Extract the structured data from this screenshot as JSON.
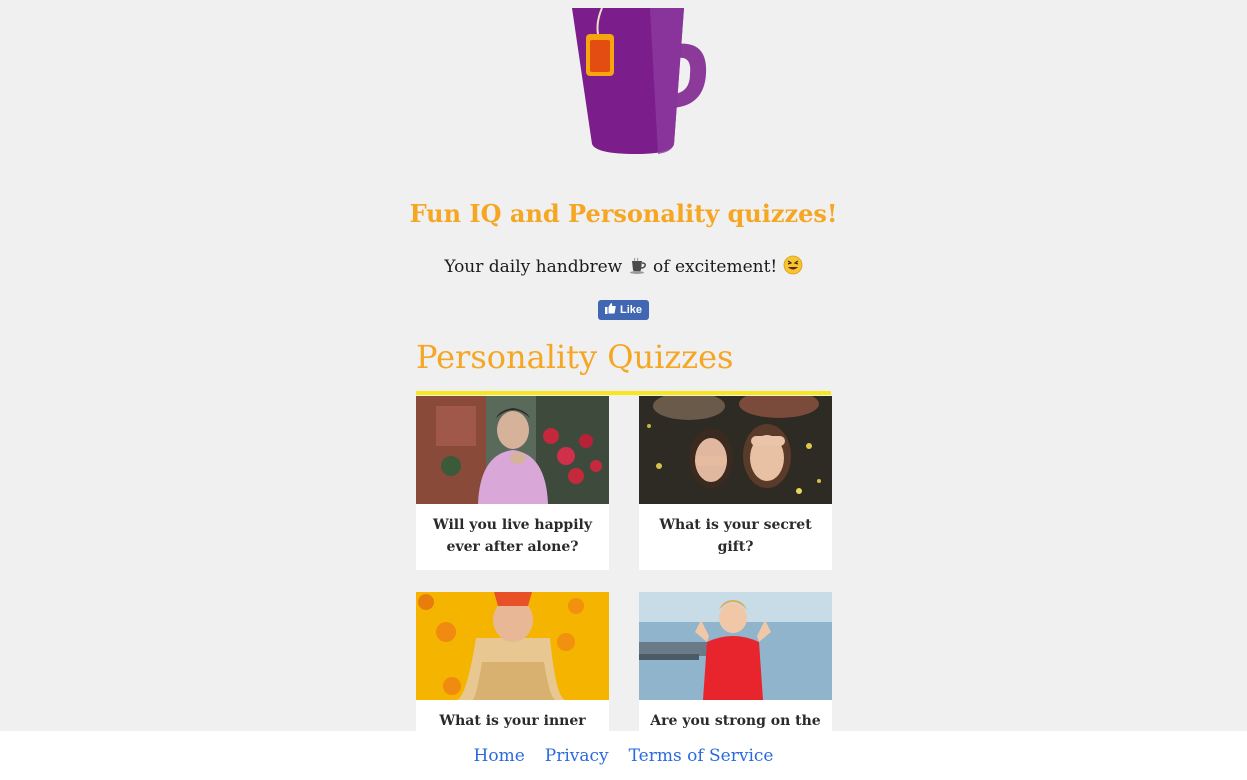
{
  "header": {
    "logo_icon": "tea-mug-icon",
    "title": "Fun IQ and Personality quizzes!",
    "tagline_before": "Your daily handbrew ",
    "tagline_after": " of excitement! ",
    "tagline_icons": [
      "coffee-cup-icon",
      "grinning-squinting-face-icon"
    ],
    "like_label": "Like"
  },
  "colors": {
    "accent": "#f5a623",
    "rule": "#f8e71c",
    "mug": "#7b1e8c",
    "facebook": "#4267b2",
    "link": "#2a6adf"
  },
  "section": {
    "title": "Personality Quizzes"
  },
  "quizzes": [
    {
      "title": "Will you live happily ever after alone?"
    },
    {
      "title": "What is your secret gift?"
    },
    {
      "title": "What is your inner style?"
    },
    {
      "title": "Are you strong on the"
    }
  ],
  "footer": {
    "links": [
      "Home",
      "Privacy",
      "Terms of Service"
    ]
  }
}
